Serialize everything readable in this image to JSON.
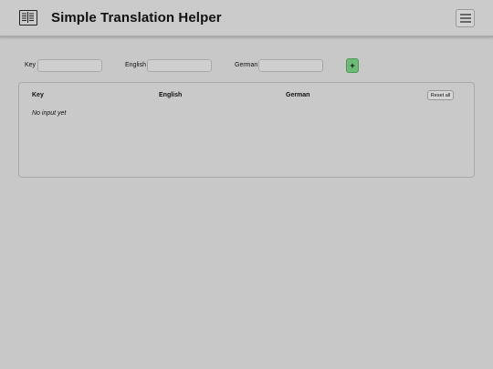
{
  "header": {
    "title": "Simple Translation Helper",
    "logo_icon": "book-open-icon",
    "menu_icon": "hamburger-menu-icon"
  },
  "form": {
    "key_label": "Key",
    "english_label": "English",
    "german_label": "German",
    "key_value": "",
    "english_value": "",
    "german_value": "",
    "add_label": "+",
    "add_color": "#6fba78"
  },
  "table": {
    "columns": [
      "Key",
      "English",
      "German"
    ],
    "reset_label": "Reset all",
    "empty_message": "No input yet"
  }
}
